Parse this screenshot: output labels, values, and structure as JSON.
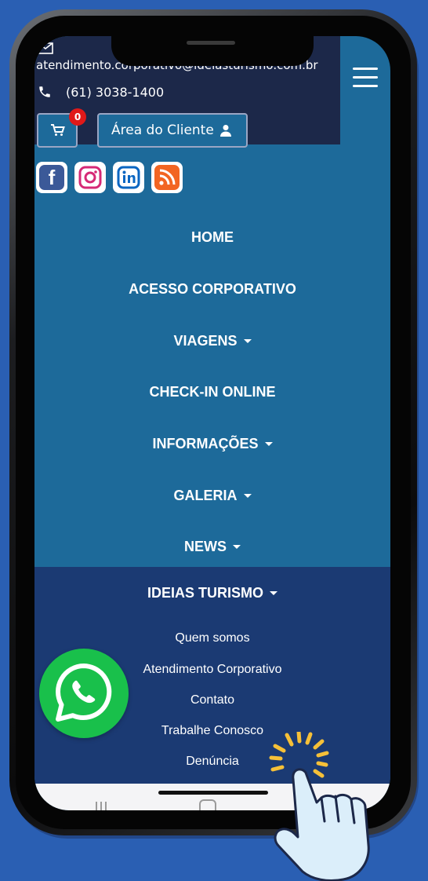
{
  "topbar": {
    "email": "atendimento.corporativo@ideiasturismo.com.br",
    "phone": "(61) 3038-1400",
    "cart_count": "0",
    "client_area_label": "Área do Cliente"
  },
  "social": [
    {
      "name": "facebook",
      "color": "#3b5998"
    },
    {
      "name": "instagram",
      "color": "#d62976"
    },
    {
      "name": "linkedin",
      "color": "#0a66c2"
    },
    {
      "name": "rss",
      "color": "#f26522"
    }
  ],
  "menu": {
    "items": [
      {
        "label": "HOME",
        "dropdown": false
      },
      {
        "label": "ACESSO CORPORATIVO",
        "dropdown": false
      },
      {
        "label": "VIAGENS",
        "dropdown": true
      },
      {
        "label": "CHECK-IN ONLINE",
        "dropdown": false
      },
      {
        "label": "INFORMAÇÕES",
        "dropdown": true
      },
      {
        "label": "GALERIA",
        "dropdown": true
      },
      {
        "label": "NEWS",
        "dropdown": true
      }
    ],
    "open_item": "IDEIAS TURISMO",
    "submenu": [
      "Quem somos",
      "Atendimento Corporativo",
      "Contato",
      "Trabalhe Conosco",
      "Denúncia"
    ]
  },
  "colors": {
    "background": "#2a5fb3",
    "menu_bg": "#1d6a9a",
    "topbar_bg": "#1c2849",
    "submenu_bg": "#1b3a73",
    "whatsapp": "#19c04b"
  }
}
